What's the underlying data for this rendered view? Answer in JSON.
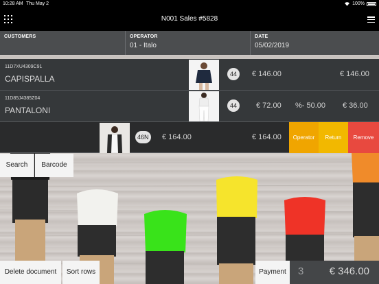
{
  "status_bar": {
    "time": "10:28 AM",
    "date": "Thu May 2",
    "battery": "100%"
  },
  "header": {
    "title": "N001 Sales #5828"
  },
  "info": {
    "customers_label": "CUSTOMERS",
    "operator_label": "OPERATOR",
    "operator_value": "01 - Italo",
    "date_label": "DATE",
    "date_value": "05/02/2019"
  },
  "rows": [
    {
      "code": "11D7XU4309C91",
      "name": "CAPISPALLA",
      "qty": "44",
      "price": "€ 146.00",
      "discount": "",
      "total": "€ 146.00"
    },
    {
      "code": "11D85J4385Z04",
      "name": "PANTALONI",
      "qty": "44",
      "price": "€ 72.00",
      "discount": "%- 50.00",
      "total": "€ 36.00"
    }
  ],
  "selected_row": {
    "size": "46N",
    "price": "€ 164.00",
    "total": "€ 164.00"
  },
  "row_actions": {
    "operator": "Operator",
    "return": "Return",
    "remove": "Remove"
  },
  "row_action_colors": {
    "operator": "#f0a500",
    "return": "#f2b800",
    "remove": "#e8493f"
  },
  "search_buttons": {
    "search": "Search",
    "barcode": "Barcode"
  },
  "footer": {
    "delete": "Delete document",
    "sort": "Sort rows",
    "payment": "Payment",
    "count": "3",
    "total": "€ 346.00"
  }
}
